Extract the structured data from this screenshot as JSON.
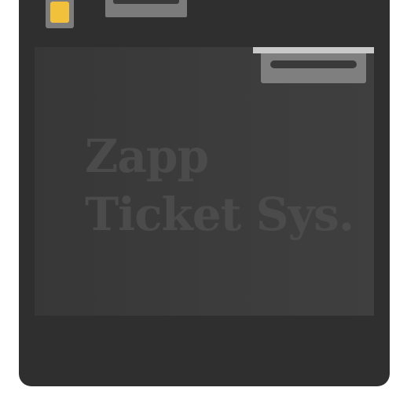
{
  "machine": {
    "body_color": "#2f2f2f",
    "panel_color": "#3c3c3c",
    "indicator": {
      "color": "#f2c13b",
      "icon": "status-light-icon"
    },
    "brand": {
      "line1": "Zapp",
      "line2": "Ticket Sys."
    }
  }
}
